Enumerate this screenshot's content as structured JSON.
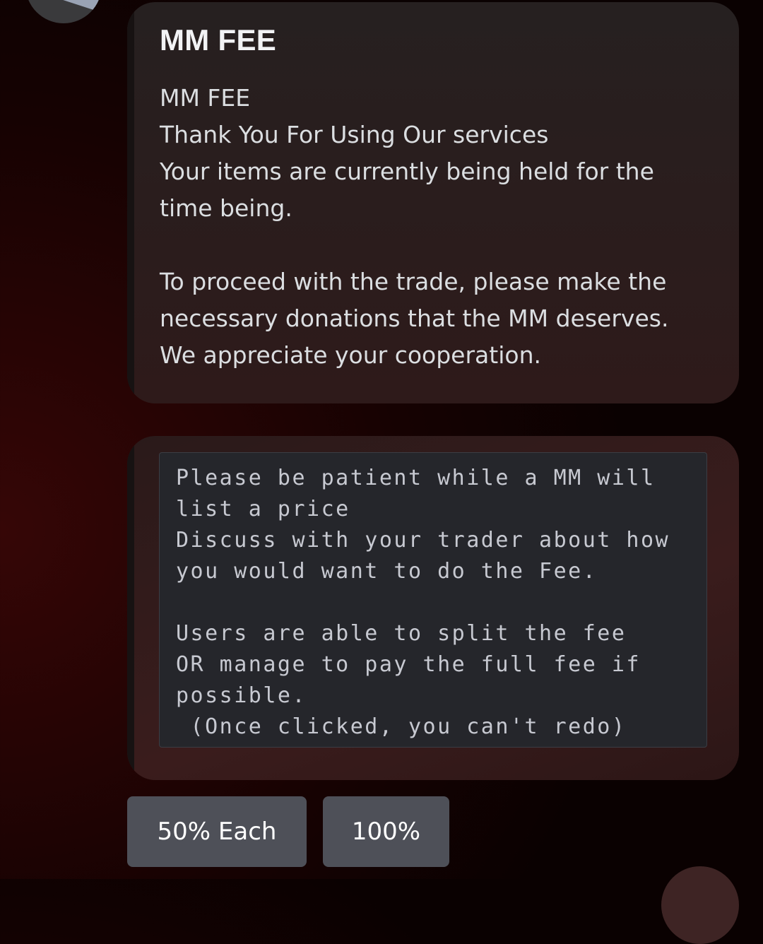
{
  "embed_fee": {
    "title": "MM FEE",
    "body_lines": [
      "MM FEE",
      "Thank You For Using Our services",
      "Your items are currently being held for the",
      "time being.",
      "",
      "To proceed with the trade, please make the",
      "necessary donations that the MM deserves.",
      "We appreciate your cooperation."
    ]
  },
  "embed_info": {
    "code_lines": [
      "Please be patient while a MM will",
      "list a price",
      "Discuss with your trader about how",
      "you would want to do the Fee.",
      "",
      "Users are able to split the fee",
      "OR manage to pay the full fee if",
      "possible.",
      " (Once clicked, you can't redo)"
    ]
  },
  "buttons": {
    "split_label": "50% Each",
    "full_label": "100%"
  },
  "colors": {
    "button_bg": "#4e5058",
    "embed_accent": "#171212",
    "code_bg": "#25262b"
  }
}
